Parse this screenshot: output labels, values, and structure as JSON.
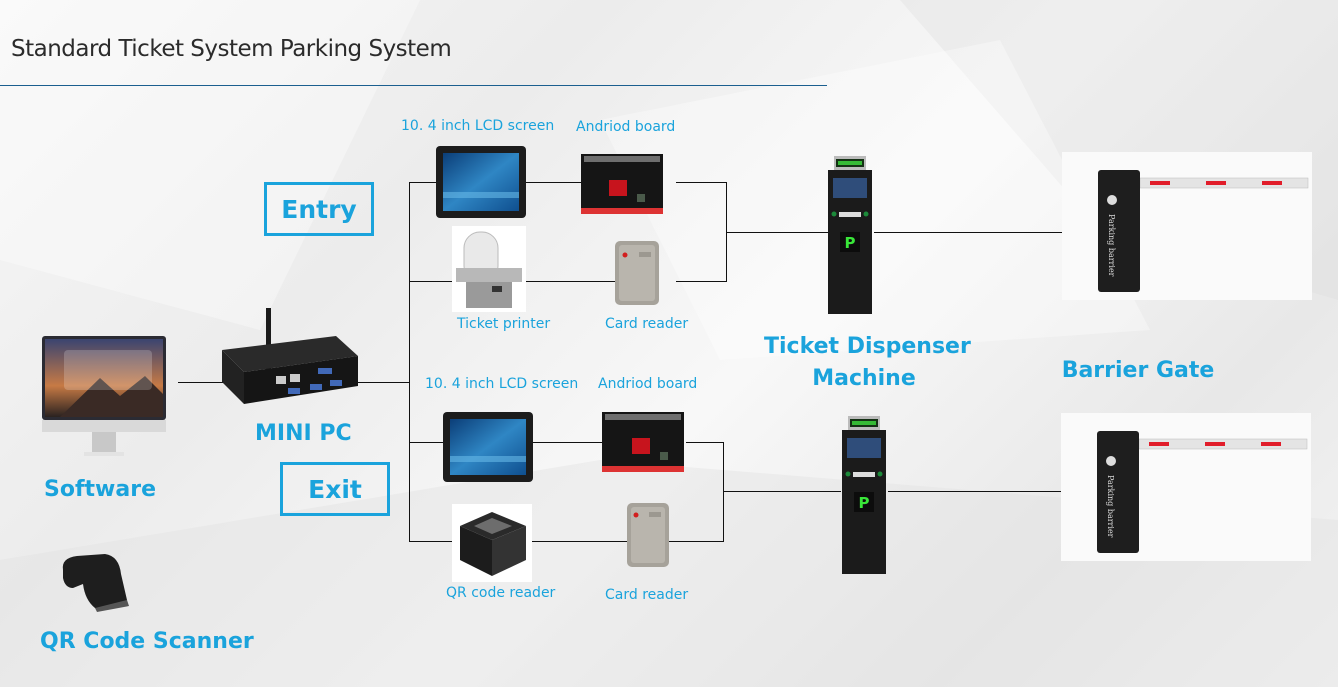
{
  "title": "Standard Ticket System Parking System",
  "sections": {
    "entry": "Entry",
    "exit": "Exit"
  },
  "left": {
    "software": "Software",
    "mini_pc": "MINI PC",
    "qr_scanner": "QR Code Scanner"
  },
  "entry_devices": {
    "lcd": "10. 4 inch LCD screen",
    "board": "Andriod board",
    "printer": "Ticket printer",
    "card_reader": "Card reader"
  },
  "exit_devices": {
    "lcd": "10. 4 inch LCD screen",
    "board": "Andriod board",
    "qr_reader": "QR code reader",
    "card_reader": "Card reader"
  },
  "right": {
    "dispenser_line1": "Ticket Dispenser",
    "dispenser_line2": "Machine",
    "barrier": "Barrier Gate",
    "barrier_text": "Parking barrier",
    "p_sign": "P"
  },
  "colors": {
    "accent": "#1aa3dc",
    "rule": "#1b5f8f",
    "line": "#111111"
  }
}
